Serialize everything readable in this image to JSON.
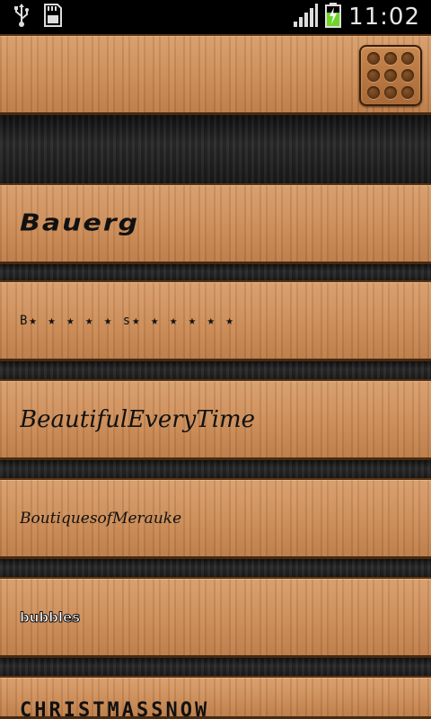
{
  "status_bar": {
    "time": "11:02",
    "icons": [
      "usb-icon",
      "sd-card-icon",
      "signal-icon",
      "battery-charging-icon"
    ]
  },
  "header": {
    "menu_icon": "grid-menu-icon"
  },
  "fonts": [
    {
      "label": "Bauerg"
    },
    {
      "label": "B★ ★ ★ ★ ★ s★ ★ ★ ★ ★ ★"
    },
    {
      "label": "BeautifulEveryTime"
    },
    {
      "label": "BoutiquesofMerauke"
    },
    {
      "label": "bubbles"
    },
    {
      "label": "CHRISTMASSNOW"
    }
  ],
  "colors": {
    "wood": "#c98d5c",
    "dark_gap": "#262626",
    "status_bar": "#000000"
  }
}
